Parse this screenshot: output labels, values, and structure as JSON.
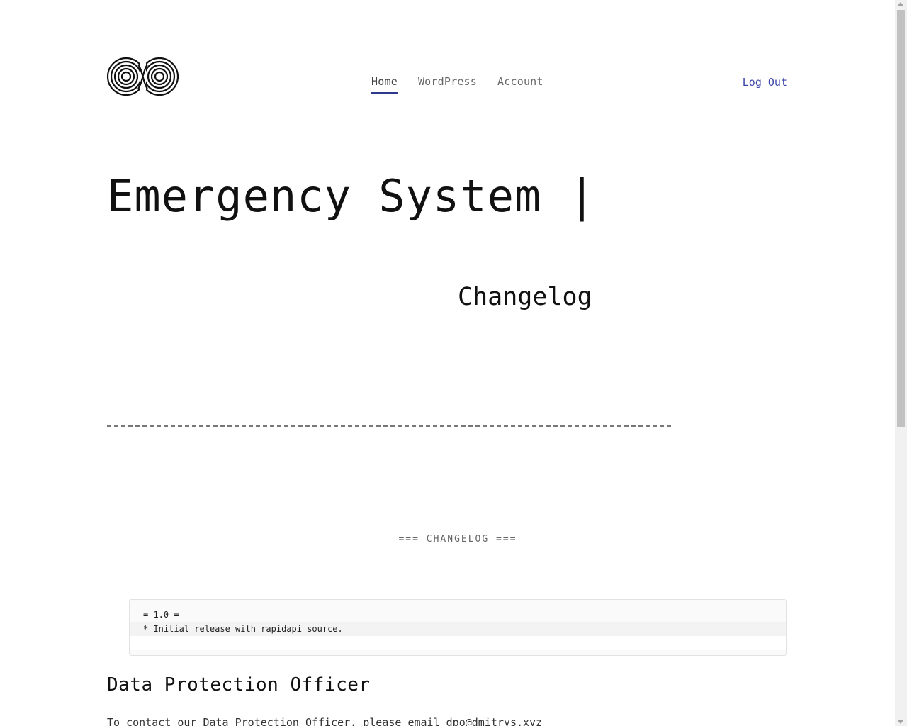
{
  "header": {
    "logo_icon": "infinity-spiral-logo",
    "nav": [
      {
        "label": "Home",
        "active": true
      },
      {
        "label": "WordPress",
        "active": false
      },
      {
        "label": "Account",
        "active": false
      }
    ],
    "logout_label": "Log Out",
    "accent_color": "#3b45a8"
  },
  "hero": {
    "title": "Emergency System |",
    "subtitle": "Changelog"
  },
  "changelog": {
    "heading": "=== CHANGELOG ===",
    "lines": [
      "= 1.0 =",
      "* Initial release with rapidapi source."
    ]
  },
  "dpo": {
    "heading": "Data Protection Officer",
    "text": "To contact our Data Protection Officer, please email dpo@dmitrys.xyz"
  }
}
